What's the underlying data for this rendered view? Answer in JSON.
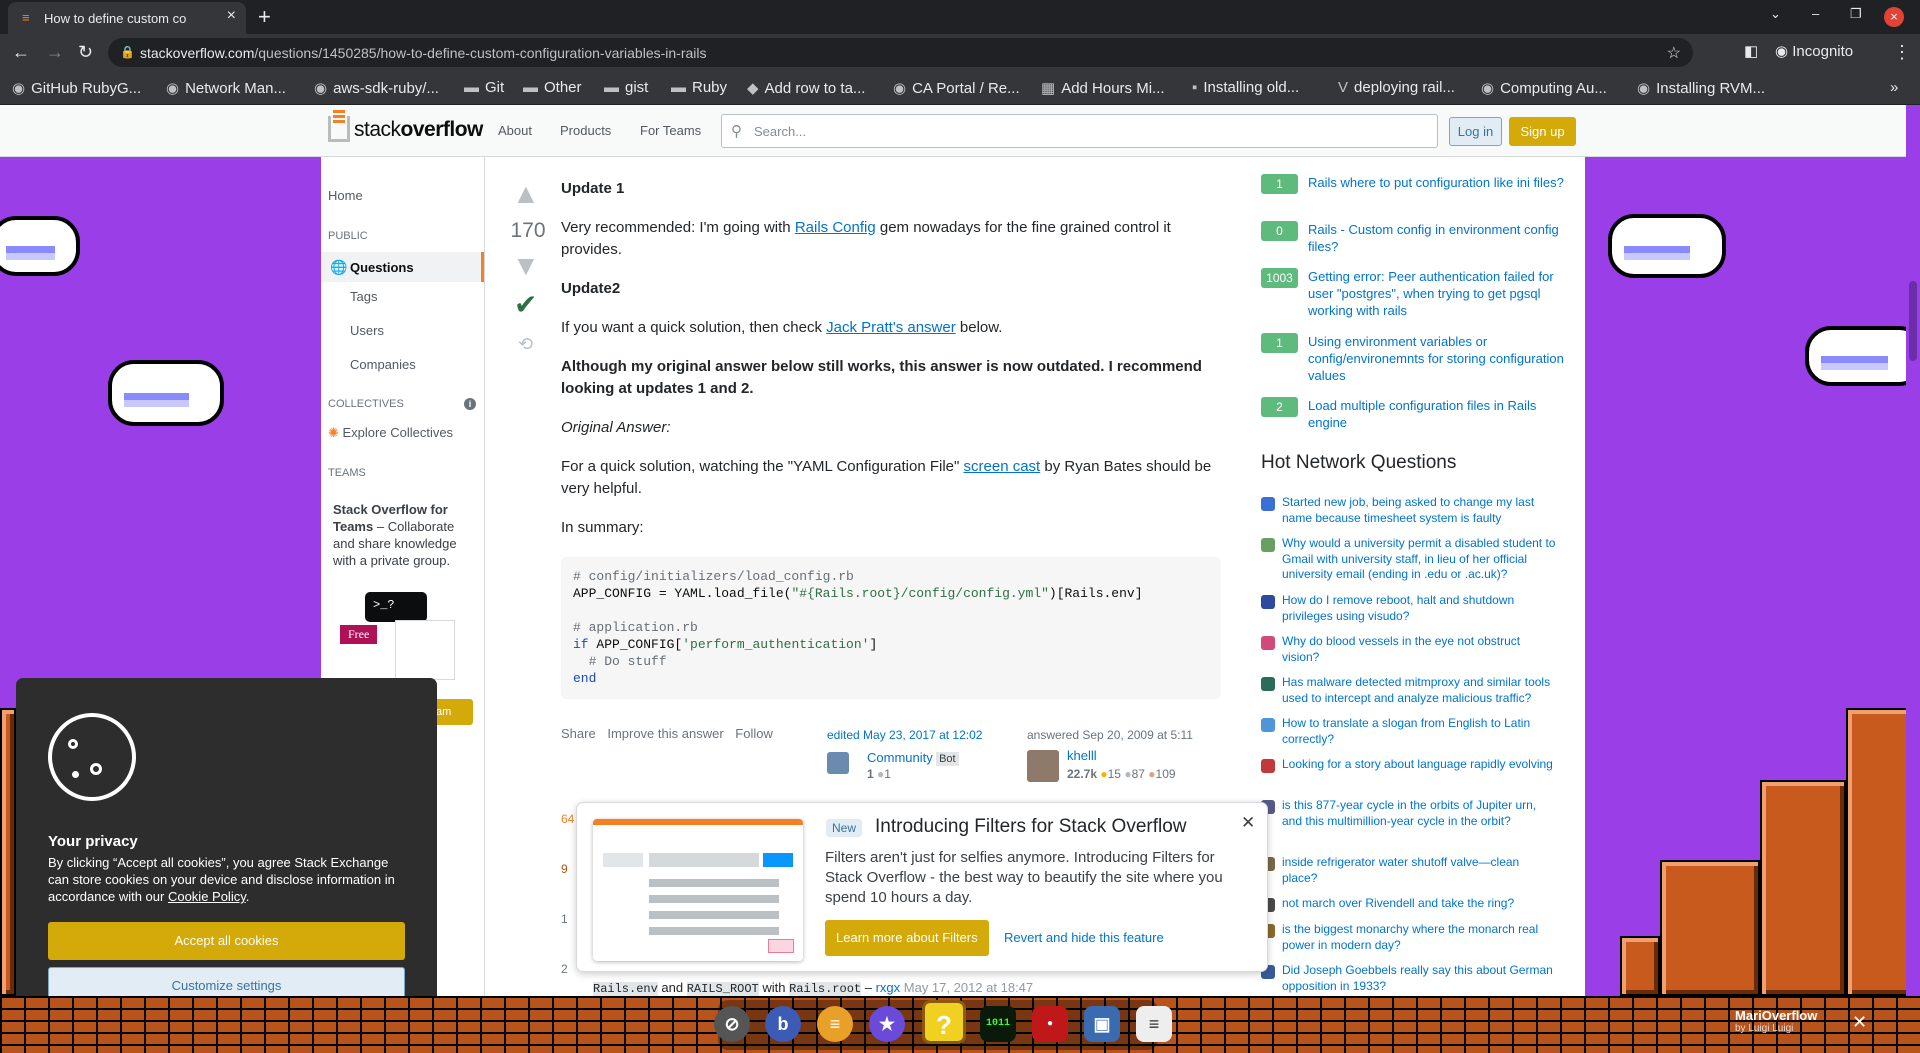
{
  "browser": {
    "tab_title": "How to define custom co",
    "url_host": "stackoverflow.com",
    "url_path": "/questions/1450285/how-to-define-custom-configuration-variables-in-rails",
    "profile": "Incognito",
    "bookmarks": [
      "GitHub RubyG...",
      "Network Man...",
      "aws-sdk-ruby/...",
      "Git",
      "Other",
      "gist",
      "Ruby",
      "Add row to ta...",
      "CA Portal / Re...",
      "Add Hours Mi...",
      "Installing old...",
      "deploying rail...",
      "Computing Au...",
      "Installing RVM..."
    ]
  },
  "header": {
    "logo_light": "stack",
    "logo_bold": "overflow",
    "nav": [
      "About",
      "Products",
      "For Teams"
    ],
    "search_placeholder": "Search...",
    "login": "Log in",
    "signup": "Sign up"
  },
  "leftnav": {
    "home": "Home",
    "public": "PUBLIC",
    "questions": "Questions",
    "tags": "Tags",
    "users": "Users",
    "companies": "Companies",
    "collectives": "COLLECTIVES",
    "explore": "Explore Collectives",
    "teams": "TEAMS",
    "teams_bold": "Stack Overflow for Teams",
    "teams_text": " – Collaborate and share knowledge with a private group.",
    "free_badge": "Free",
    "create_team_fragment": "am"
  },
  "answer": {
    "score": "170",
    "update1": "Update 1",
    "p1_a": "Very recommended: I'm going with ",
    "p1_link": "Rails Config",
    "p1_b": " gem nowadays for the fine grained control it provides.",
    "update2": "Update2",
    "p2_a": "If you want a quick solution, then check ",
    "p2_link": "Jack Pratt's answer",
    "p2_b": " below.",
    "bold": "Although my original answer below still works, this answer is now outdated. I recommend looking at updates 1 and 2.",
    "original": "Original Answer:",
    "p3_a": "For a quick solution, watching the \"YAML Configuration File\" ",
    "p3_link": "screen cast",
    "p3_b": " by Ryan Bates should be very helpful.",
    "summary": "In summary:",
    "code_c1": "# config/initializers/load_config.rb",
    "code_l2a": "APP_CONFIG = YAML.load_file(",
    "code_l2s": "\"#{Rails.root}/config/config.yml\"",
    "code_l2b": ")[Rails.env]",
    "code_c2": "# application.rb",
    "code_if": "if",
    "code_l4a": " APP_CONFIG[",
    "code_l4s": "'perform_authentication'",
    "code_l4b": "]",
    "code_c3": "  # Do stuff",
    "code_end": "end",
    "share": "Share",
    "improve": "Improve this answer",
    "follow": "Follow",
    "edited": "edited May 23, 2017 at 12:02",
    "editor": "Community",
    "bot": "Bot",
    "editor_rep": "1",
    "editor_badge": "1",
    "answered": "answered Sep 20, 2009 at 5:11",
    "author": "khelll",
    "author_rep": "22.7k",
    "gold": "15",
    "silver": "87",
    "bronze": "109",
    "comment_scores": [
      "64",
      "9",
      "1",
      "2"
    ],
    "comment_tail_code1": "Rails.env",
    "comment_tail_and": " and ",
    "comment_tail_code2": "RAILS_ROOT",
    "comment_tail_with": " with ",
    "comment_tail_code3": "Rails.root",
    "comment_tail_user": "rxgx",
    "comment_tail_date": "May 17, 2012 at 18:47"
  },
  "related": [
    {
      "count": "1",
      "title": "Rails where to put configuration like ini files?"
    },
    {
      "count": "0",
      "title": "Rails - Custom config in environment config files?"
    },
    {
      "count": "1003",
      "title": "Getting error: Peer authentication failed for user \"postgres\", when trying to get pgsql working with rails"
    },
    {
      "count": "1",
      "title": "Using environment variables or config/environemnts for storing configuration values"
    },
    {
      "count": "2",
      "title": "Load multiple configuration files in Rails engine"
    }
  ],
  "hnq_title": "Hot Network Questions",
  "hnq": [
    "Started new job, being asked to change my last name because timesheet system is faulty",
    "Why would a university permit a disabled student to Gmail with university staff, in lieu of her official university email (ending in .edu or .ac.uk)?",
    "How do I remove reboot, halt and shutdown privileges using visudo?",
    "Why do blood vessels in the eye not obstruct vision?",
    "Has malware detected mitmproxy and similar tools used to intercept and analyze malicious traffic?",
    "How to translate a slogan from English to Latin correctly?",
    "Looking for a story about language rapidly evolving",
    "is this 877-year cycle in the orbits of Jupiter urn, and this multimillion-year cycle in the orbit?",
    "inside refrigerator water shutoff valve—clean place?",
    "not march over Rivendell and take the ring?",
    "is the biggest monarchy where the monarch real power in modern day?",
    "Did Joseph Goebbels really say this about German opposition in 1933?"
  ],
  "popup": {
    "badge": "New",
    "title": "Introducing Filters for Stack Overflow",
    "desc": "Filters aren't just for selfies anymore. Introducing Filters for Stack Overflow - the best way to beautify the site where you spend 10 hours a day.",
    "learn": "Learn more about Filters",
    "revert": "Revert and hide this feature"
  },
  "privacy": {
    "title": "Your privacy",
    "text_a": "By clicking “Accept all cookies”, you agree Stack Exchange can store cookies on your device and disclose information in accordance with our ",
    "policy": "Cookie Policy",
    "text_b": ".",
    "accept": "Accept all cookies",
    "customize": "Customize settings"
  },
  "extension": {
    "name": "MariOverflow",
    "by": "by Luigi Luigi"
  },
  "colors": {
    "accent": "#f48024",
    "link": "#0074cc",
    "background": "#9a3fe8",
    "answered_count": "#5eba7d"
  }
}
